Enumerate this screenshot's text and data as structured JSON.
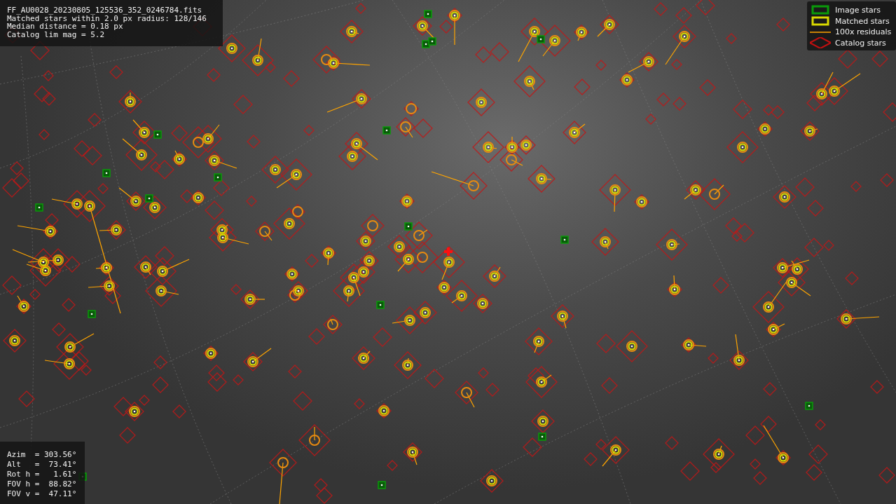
{
  "file_info": {
    "lines": [
      "FF_AU0028_20230805_125536_352_0246784.fits",
      "Matched stars within 2.0 px radius: 128/146",
      "Median distance = 0.18 px",
      "Catalog lim mag = 5.2"
    ]
  },
  "legend": {
    "items": [
      {
        "kind": "image",
        "label": "Image stars"
      },
      {
        "kind": "matched",
        "label": "Matched stars"
      },
      {
        "kind": "residual",
        "label": "100x residuals"
      },
      {
        "kind": "catalog",
        "label": "Catalog stars"
      }
    ]
  },
  "pointing": {
    "lines": [
      "Azim  = 303.56°",
      "Alt   =  73.41°",
      "Rot h =   1.61°",
      "FOV h =  88.82°",
      "FOV v =  47.11°"
    ]
  }
}
